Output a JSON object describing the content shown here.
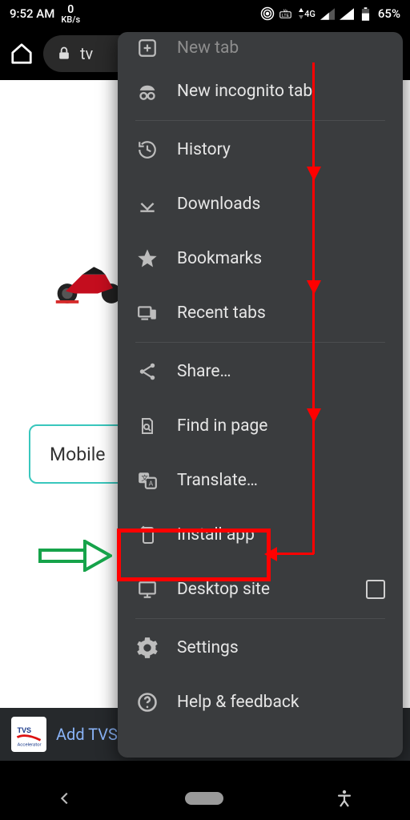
{
  "status": {
    "time": "9:52 AM",
    "kb_value": "0",
    "kb_unit": "KB/s",
    "network_label": "4G",
    "battery_pct": "65%"
  },
  "address_bar": {
    "url_visible": "tv"
  },
  "page": {
    "button_label": "Mobile",
    "banner_text": "Add TVS"
  },
  "menu": {
    "items": [
      {
        "id": "new-tab",
        "label": "New tab",
        "icon": "plus-box",
        "dim": true
      },
      {
        "id": "incognito",
        "label": "New incognito tab",
        "icon": "incognito"
      },
      {
        "sep": true
      },
      {
        "id": "history",
        "label": "History",
        "icon": "history"
      },
      {
        "id": "downloads",
        "label": "Downloads",
        "icon": "download-underline"
      },
      {
        "id": "bookmarks",
        "label": "Bookmarks",
        "icon": "star"
      },
      {
        "id": "recent-tabs",
        "label": "Recent tabs",
        "icon": "devices"
      },
      {
        "sep": true
      },
      {
        "id": "share",
        "label": "Share…",
        "icon": "share"
      },
      {
        "id": "find",
        "label": "Find in page",
        "icon": "page-search"
      },
      {
        "id": "translate",
        "label": "Translate…",
        "icon": "translate"
      },
      {
        "id": "install",
        "label": "Install app",
        "icon": "install",
        "highlighted": true
      },
      {
        "id": "desktop-site",
        "label": "Desktop site",
        "icon": "monitor",
        "trailing": "checkbox"
      },
      {
        "sep": true
      },
      {
        "id": "settings",
        "label": "Settings",
        "icon": "gear"
      },
      {
        "id": "help",
        "label": "Help & feedback",
        "icon": "help-circle"
      }
    ]
  }
}
